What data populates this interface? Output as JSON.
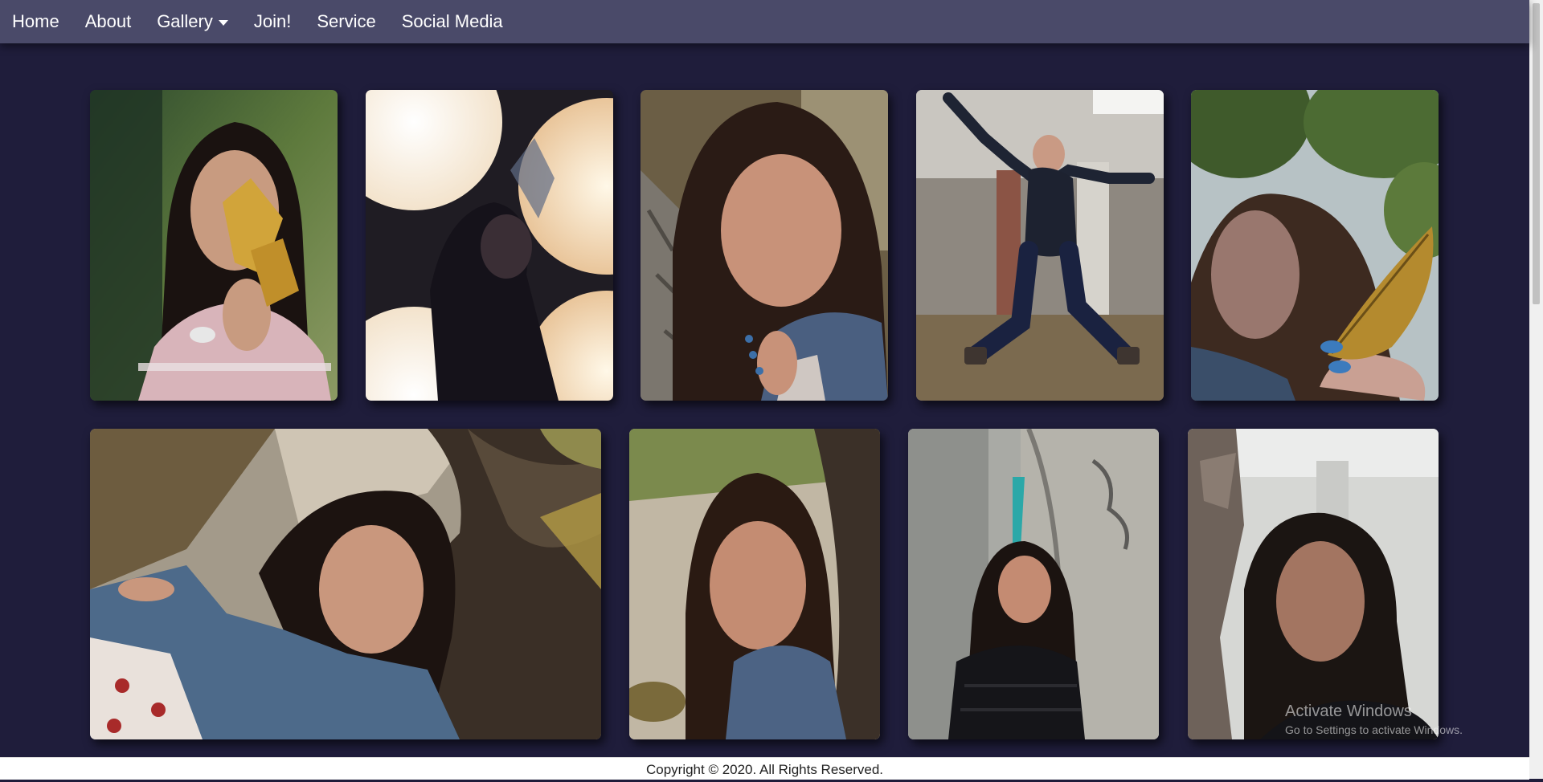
{
  "nav": {
    "items": [
      {
        "label": "Home"
      },
      {
        "label": "About"
      },
      {
        "label": "Gallery"
      },
      {
        "label": "Join!"
      },
      {
        "label": "Service"
      },
      {
        "label": "Social Media"
      }
    ]
  },
  "gallery": {
    "photos": [
      {
        "subject": "girl in striped t-shirt holding autumn leaves"
      },
      {
        "subject": "silhouette of girl framed by bokeh lights"
      },
      {
        "subject": "girl in denim jacket leaning on tree trunk"
      },
      {
        "subject": "girl jumping with arms spread in front of ruins"
      },
      {
        "subject": "girl holding a yellow leaf with blue nails"
      },
      {
        "subject": "girl lying against tree in denim jacket and floral dress"
      },
      {
        "subject": "girl in denim jacket beside tree on hillside"
      },
      {
        "subject": "girl in black puffer jacket beside concrete pillar"
      },
      {
        "subject": "girl in dark jacket inside abandoned building"
      }
    ]
  },
  "footer": {
    "copyright": "Copyright © 2020. All Rights Reserved."
  },
  "watermark": {
    "title": "Activate Windows",
    "subtitle": "Go to Settings to activate Windows."
  },
  "colors": {
    "page_background": "#1f1d3b",
    "navbar_background": "#4a4a69",
    "footer_background": "#ffffff"
  }
}
